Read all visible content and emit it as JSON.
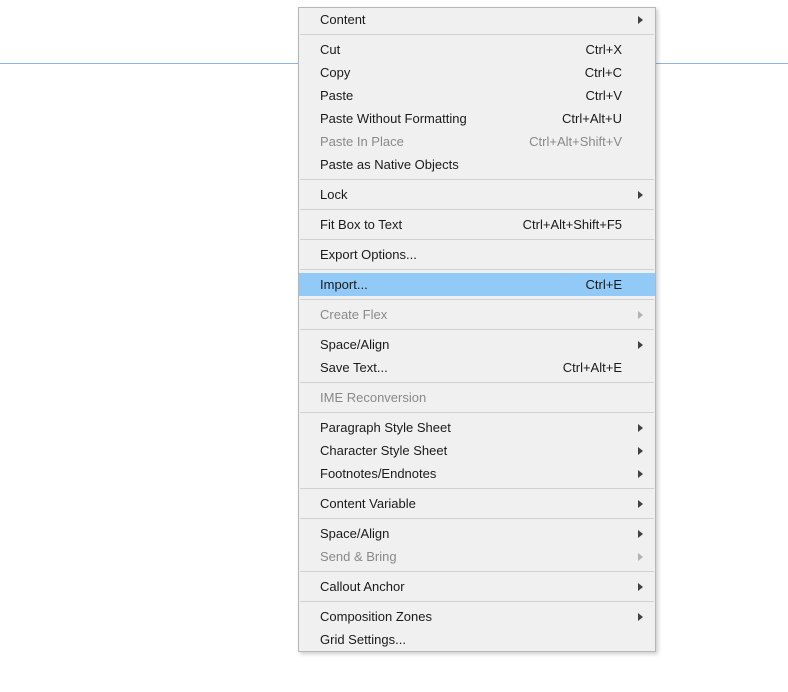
{
  "menu": {
    "items": [
      {
        "label": "Content",
        "shortcut": "",
        "arrow": true,
        "disabled": false,
        "highlighted": false
      },
      {
        "separator": true
      },
      {
        "label": "Cut",
        "shortcut": "Ctrl+X",
        "arrow": false,
        "disabled": false,
        "highlighted": false
      },
      {
        "label": "Copy",
        "shortcut": "Ctrl+C",
        "arrow": false,
        "disabled": false,
        "highlighted": false
      },
      {
        "label": "Paste",
        "shortcut": "Ctrl+V",
        "arrow": false,
        "disabled": false,
        "highlighted": false
      },
      {
        "label": "Paste Without Formatting",
        "shortcut": "Ctrl+Alt+U",
        "arrow": false,
        "disabled": false,
        "highlighted": false
      },
      {
        "label": "Paste In Place",
        "shortcut": "Ctrl+Alt+Shift+V",
        "arrow": false,
        "disabled": true,
        "highlighted": false
      },
      {
        "label": "Paste as Native Objects",
        "shortcut": "",
        "arrow": false,
        "disabled": false,
        "highlighted": false
      },
      {
        "separator": true
      },
      {
        "label": "Lock",
        "shortcut": "",
        "arrow": true,
        "disabled": false,
        "highlighted": false
      },
      {
        "separator": true
      },
      {
        "label": "Fit Box to Text",
        "shortcut": "Ctrl+Alt+Shift+F5",
        "arrow": false,
        "disabled": false,
        "highlighted": false
      },
      {
        "separator": true
      },
      {
        "label": "Export Options...",
        "shortcut": "",
        "arrow": false,
        "disabled": false,
        "highlighted": false
      },
      {
        "separator": true
      },
      {
        "label": "Import...",
        "shortcut": "Ctrl+E",
        "arrow": false,
        "disabled": false,
        "highlighted": true
      },
      {
        "separator": true
      },
      {
        "label": "Create Flex",
        "shortcut": "",
        "arrow": true,
        "disabled": true,
        "highlighted": false
      },
      {
        "separator": true
      },
      {
        "label": "Space/Align",
        "shortcut": "",
        "arrow": true,
        "disabled": false,
        "highlighted": false
      },
      {
        "label": "Save Text...",
        "shortcut": "Ctrl+Alt+E",
        "arrow": false,
        "disabled": false,
        "highlighted": false
      },
      {
        "separator": true
      },
      {
        "label": "IME Reconversion",
        "shortcut": "",
        "arrow": false,
        "disabled": true,
        "highlighted": false
      },
      {
        "separator": true
      },
      {
        "label": "Paragraph Style Sheet",
        "shortcut": "",
        "arrow": true,
        "disabled": false,
        "highlighted": false
      },
      {
        "label": "Character Style Sheet",
        "shortcut": "",
        "arrow": true,
        "disabled": false,
        "highlighted": false
      },
      {
        "label": "Footnotes/Endnotes",
        "shortcut": "",
        "arrow": true,
        "disabled": false,
        "highlighted": false
      },
      {
        "separator": true
      },
      {
        "label": "Content Variable",
        "shortcut": "",
        "arrow": true,
        "disabled": false,
        "highlighted": false
      },
      {
        "separator": true
      },
      {
        "label": "Space/Align",
        "shortcut": "",
        "arrow": true,
        "disabled": false,
        "highlighted": false
      },
      {
        "label": "Send & Bring",
        "shortcut": "",
        "arrow": true,
        "disabled": true,
        "highlighted": false
      },
      {
        "separator": true
      },
      {
        "label": "Callout Anchor",
        "shortcut": "",
        "arrow": true,
        "disabled": false,
        "highlighted": false
      },
      {
        "separator": true
      },
      {
        "label": "Composition Zones",
        "shortcut": "",
        "arrow": true,
        "disabled": false,
        "highlighted": false
      },
      {
        "label": "Grid Settings...",
        "shortcut": "",
        "arrow": false,
        "disabled": false,
        "highlighted": false
      }
    ]
  }
}
